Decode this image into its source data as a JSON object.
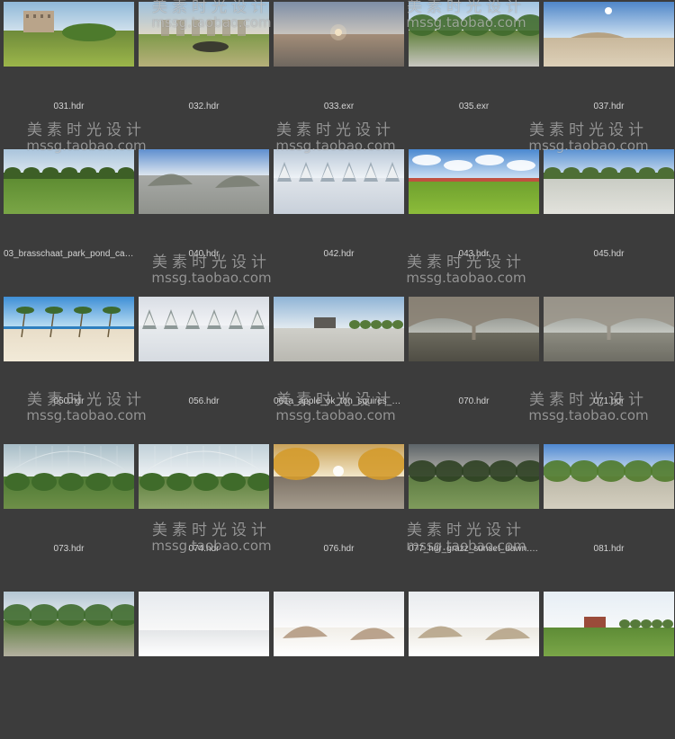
{
  "watermark": {
    "text": "美素时光设计",
    "url": "mssg.taobao.com"
  },
  "thumbnails": [
    {
      "label": "031.hdr",
      "scene": {
        "sky": [
          "#8fb8d8",
          "#cfe0ec"
        ],
        "ground": [
          "#6e8a3a",
          "#9cb64a"
        ],
        "horizon": 0.45,
        "feature": "building",
        "fc": "#b9a48a"
      }
    },
    {
      "label": "032.hdr",
      "scene": {
        "sky": [
          "#9dc0dc",
          "#dcd6c8"
        ],
        "ground": [
          "#7f9a4a",
          "#b6b07a"
        ],
        "horizon": 0.5,
        "feature": "ruins",
        "fc": "#a7a08d"
      }
    },
    {
      "label": "033.exr",
      "scene": {
        "sky": [
          "#7e8ea6",
          "#c7c3bd"
        ],
        "ground": [
          "#a38d78",
          "#6f675f"
        ],
        "horizon": 0.5,
        "feature": "sun",
        "fc": "#f3e2c4"
      }
    },
    {
      "label": "035.exr",
      "scene": {
        "sky": [
          "#9fc2e0",
          "#e6eef4"
        ],
        "ground": [
          "#5f7f3a",
          "#c8c6c0"
        ],
        "horizon": 0.45,
        "feature": "trees",
        "fc": "#3f6a2c"
      }
    },
    {
      "label": "037.hdr",
      "scene": {
        "sky": [
          "#4f86c8",
          "#cfe2f2"
        ],
        "ground": [
          "#c9b89c",
          "#ddd0b8"
        ],
        "horizon": 0.55,
        "feature": "hill",
        "fc": "#b6a283"
      }
    },
    {
      "label": "03_brasschaat_park_pond_cas...",
      "scene": {
        "sky": [
          "#a9c4dc",
          "#e4ecf2"
        ],
        "ground": [
          "#5e8c32",
          "#7aa646"
        ],
        "horizon": 0.45,
        "feature": "treeline",
        "fc": "#3d5f26"
      }
    },
    {
      "label": "040.hdr",
      "scene": {
        "sky": [
          "#5e8fcf",
          "#dce6ef"
        ],
        "ground": [
          "#a7a9a6",
          "#8f928c"
        ],
        "horizon": 0.4,
        "feature": "rocks",
        "fc": "#7b7f74"
      }
    },
    {
      "label": "042.hdr",
      "scene": {
        "sky": [
          "#b9c8d8",
          "#eef2f6"
        ],
        "ground": [
          "#dfe4ea",
          "#c8d0da"
        ],
        "horizon": 0.45,
        "feature": "snowtrees",
        "fc": "#8a9aa6"
      }
    },
    {
      "label": "043.hdr",
      "scene": {
        "sky": [
          "#4a88d0",
          "#d8e8f6"
        ],
        "ground": [
          "#6ea02e",
          "#8cbc3a"
        ],
        "horizon": 0.48,
        "feature": "clouds",
        "fc": "#ffffff"
      }
    },
    {
      "label": "045.hdr",
      "scene": {
        "sky": [
          "#5a92d2",
          "#d8e6f2"
        ],
        "ground": [
          "#c9ccc4",
          "#e2e2dc"
        ],
        "horizon": 0.45,
        "feature": "treeline",
        "fc": "#4d6e35"
      }
    },
    {
      "label": "050.hdr",
      "scene": {
        "sky": [
          "#3e8fd6",
          "#bfe1f4"
        ],
        "ground": [
          "#e8ddc8",
          "#f2ead8"
        ],
        "horizon": 0.48,
        "feature": "palms",
        "fc": "#3d6a2f"
      }
    },
    {
      "label": "056.hdr",
      "scene": {
        "sky": [
          "#d8dde4",
          "#f2f3f6"
        ],
        "ground": [
          "#e8ebee",
          "#d6dbe1"
        ],
        "horizon": 0.45,
        "feature": "snowtrees",
        "fc": "#6f7c7a"
      }
    },
    {
      "label": "061a_apple_ok_ton_squires_1.hdr",
      "scene": {
        "sky": [
          "#8fb4d6",
          "#e2eaf0"
        ],
        "ground": [
          "#cfcfc9",
          "#b9b8b1"
        ],
        "horizon": 0.48,
        "feature": "house",
        "fc": "#5d5a55"
      }
    },
    {
      "label": "070.hdr",
      "scene": {
        "sky": [
          "#6f7470",
          "#b9bbb4"
        ],
        "ground": [
          "#6c6a5e",
          "#4f4d44"
        ],
        "horizon": 0.55,
        "feature": "arches",
        "fc": "#8b8274"
      }
    },
    {
      "label": "071.hdr",
      "scene": {
        "sky": [
          "#7a7d78",
          "#c4c7c1"
        ],
        "ground": [
          "#8c8b80",
          "#6e6d64"
        ],
        "horizon": 0.55,
        "feature": "arches",
        "fc": "#9b968b"
      }
    },
    {
      "label": "073.hdr",
      "scene": {
        "sky": [
          "#a6bcc6",
          "#e4eaec"
        ],
        "ground": [
          "#4e7a34",
          "#6e8f48"
        ],
        "horizon": 0.5,
        "feature": "greenhouse",
        "fc": "#d8e2e6"
      }
    },
    {
      "label": "074.hdr",
      "scene": {
        "sky": [
          "#c0d0d8",
          "#eef2f4"
        ],
        "ground": [
          "#5c7f3e",
          "#8ea46a"
        ],
        "horizon": 0.5,
        "feature": "greenhouse",
        "fc": "#e6ecee"
      }
    },
    {
      "label": "076.hdr",
      "scene": {
        "sky": [
          "#c9a259",
          "#f2e6c8"
        ],
        "ground": [
          "#7e7366",
          "#a59c8e"
        ],
        "horizon": 0.5,
        "feature": "autumn",
        "fc": "#d49b2c"
      }
    },
    {
      "label": "077_hdr_grazz_sunset_dawn.hdr",
      "scene": {
        "sky": [
          "#5d6468",
          "#b8b6ae"
        ],
        "ground": [
          "#5f7d44",
          "#7f9b5c"
        ],
        "horizon": 0.5,
        "feature": "trees",
        "fc": "#2d4022"
      }
    },
    {
      "label": "081.hdr",
      "scene": {
        "sky": [
          "#4e88d0",
          "#dbe8f4"
        ],
        "ground": [
          "#bcb8a8",
          "#d4cfbf"
        ],
        "horizon": 0.5,
        "feature": "trees",
        "fc": "#4f7a2a"
      }
    },
    {
      "label": "",
      "scene": {
        "sky": [
          "#b4c6d2",
          "#e8eef2"
        ],
        "ground": [
          "#5a7c3c",
          "#b4b0a0"
        ],
        "horizon": 0.45,
        "feature": "trees",
        "fc": "#3e6a2c"
      }
    },
    {
      "label": "",
      "scene": {
        "sky": [
          "#e6eaee",
          "#f8f8f8"
        ],
        "ground": [
          "#e4e6e8",
          "#ffffff"
        ],
        "horizon": 0.6,
        "feature": "none",
        "fc": "#cccccc"
      }
    },
    {
      "label": "",
      "scene": {
        "sky": [
          "#e6e8ec",
          "#fafafa"
        ],
        "ground": [
          "#f1eee8",
          "#ffffff"
        ],
        "horizon": 0.55,
        "feature": "rocks",
        "fc": "#b49a82"
      }
    },
    {
      "label": "",
      "scene": {
        "sky": [
          "#e8ebee",
          "#fafafa"
        ],
        "ground": [
          "#ebe8e0",
          "#ffffff"
        ],
        "horizon": 0.55,
        "feature": "rocks",
        "fc": "#b6a488"
      }
    },
    {
      "label": "",
      "scene": {
        "sky": [
          "#e6eef4",
          "#f6f8fa"
        ],
        "ground": [
          "#5e8c36",
          "#7aa648"
        ],
        "horizon": 0.55,
        "feature": "house",
        "fc": "#9a4b3a"
      }
    }
  ]
}
